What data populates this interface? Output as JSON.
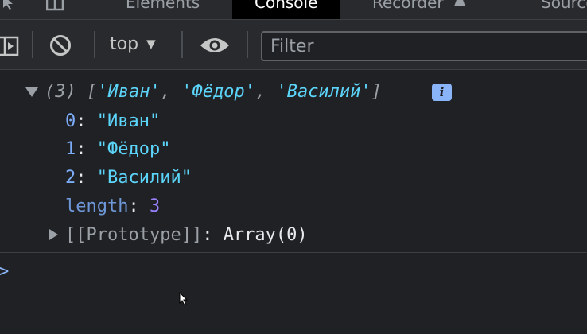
{
  "tabs": [
    {
      "label": "Elements"
    },
    {
      "label": "Console"
    },
    {
      "label": "Recorder"
    },
    {
      "label": "Sources"
    }
  ],
  "toolbar": {
    "context": "top",
    "filter_placeholder": "Filter"
  },
  "console": {
    "summary": {
      "count": "(3)",
      "open_bracket": "[",
      "items": [
        "'Иван'",
        "'Фёдор'",
        "'Василий'"
      ],
      "separator": ",",
      "close_bracket": "]",
      "info_badge": "i"
    },
    "entries": [
      {
        "key": "0",
        "value": "\"Иван\""
      },
      {
        "key": "1",
        "value": "\"Фёдор\""
      },
      {
        "key": "2",
        "value": "\"Василий\""
      }
    ],
    "length": {
      "key": "length",
      "value": "3"
    },
    "prototype": {
      "key": "[[Prototype]]",
      "value": "Array(0)"
    },
    "colon": ":",
    "prompt": ">"
  },
  "colors": {
    "background": "#202124",
    "string": "#5cd5fb",
    "key": "#7cacf8",
    "number": "#9980ff",
    "info_badge": "#8ab4f8"
  },
  "icons": [
    "select-element-icon",
    "device-toolbar-icon",
    "recorder-flask-icon",
    "sidebar-toggle-icon",
    "clear-console-icon",
    "dropdown-arrow-icon",
    "eye-icon",
    "expand-caret-icon",
    "info-icon",
    "prompt-icon",
    "mouse-cursor-icon"
  ]
}
